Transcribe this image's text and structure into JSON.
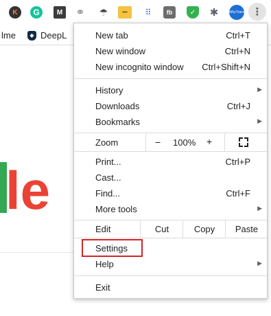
{
  "toolbar": {
    "extensions": [
      {
        "name": "k-extension-icon",
        "glyph": "K"
      },
      {
        "name": "grammarly-icon",
        "glyph": "G"
      },
      {
        "name": "m-extension-icon",
        "glyph": "M"
      },
      {
        "name": "link-icon",
        "glyph": "⚭"
      },
      {
        "name": "umbrella-icon",
        "glyph": "☂"
      },
      {
        "name": "yellow-extension-icon",
        "glyph": "•••"
      },
      {
        "name": "dots-grid-icon",
        "glyph": "⠿"
      },
      {
        "name": "fb-extension-icon",
        "glyph": "fb"
      },
      {
        "name": "shield-check-icon",
        "glyph": "✓"
      },
      {
        "name": "puzzle-icon",
        "glyph": "✱"
      },
      {
        "name": "avatar-icon",
        "glyph": "WhyTrans"
      }
    ],
    "menu_glyph": "⋮"
  },
  "bookmarks": {
    "items": [
      "lme",
      "DeepL"
    ],
    "deepl_glyph": "◆"
  },
  "page": {
    "logo_letter": "le"
  },
  "menu": {
    "new_tab": {
      "label": "New tab",
      "shortcut": "Ctrl+T"
    },
    "new_window": {
      "label": "New window",
      "shortcut": "Ctrl+N"
    },
    "new_incognito": {
      "label": "New incognito window",
      "shortcut": "Ctrl+Shift+N"
    },
    "history": {
      "label": "History"
    },
    "downloads": {
      "label": "Downloads",
      "shortcut": "Ctrl+J"
    },
    "bookmarks": {
      "label": "Bookmarks"
    },
    "zoom": {
      "label": "Zoom",
      "minus": "−",
      "value": "100%",
      "plus": "+"
    },
    "print": {
      "label": "Print...",
      "shortcut": "Ctrl+P"
    },
    "cast": {
      "label": "Cast..."
    },
    "find": {
      "label": "Find...",
      "shortcut": "Ctrl+F"
    },
    "more_tools": {
      "label": "More tools"
    },
    "edit": {
      "label": "Edit",
      "cut": "Cut",
      "copy": "Copy",
      "paste": "Paste"
    },
    "settings": {
      "label": "Settings"
    },
    "help": {
      "label": "Help"
    },
    "exit": {
      "label": "Exit"
    },
    "submenu_arrow": "▶"
  },
  "colors": {
    "highlight_border": "#d0252a",
    "logo_red": "#ea4335",
    "logo_green": "#34a853"
  }
}
